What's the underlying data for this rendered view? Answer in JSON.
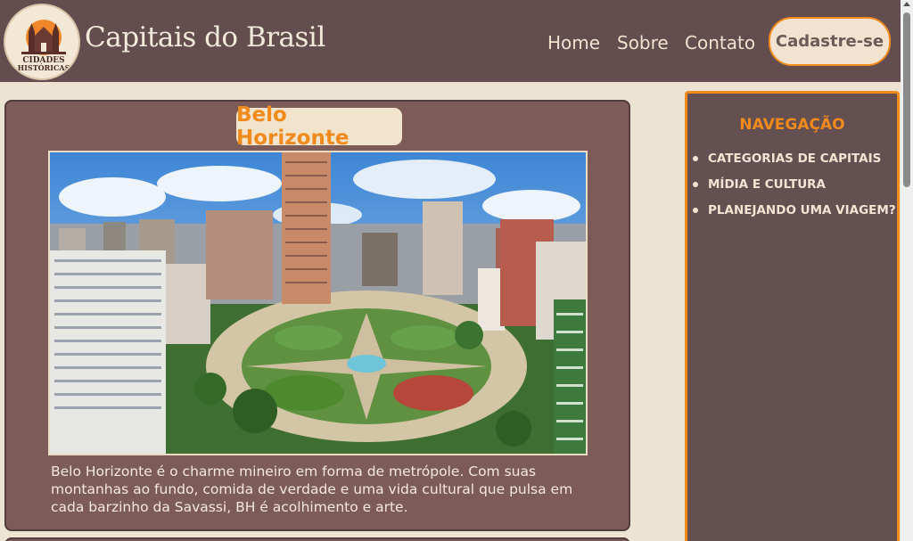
{
  "header": {
    "logo_text_line1": "CIDADES",
    "logo_text_line2": "HISTÓRICAS",
    "site_title": "Capitais do Brasil",
    "nav": {
      "home": "Home",
      "sobre": "Sobre",
      "contato": "Contato"
    },
    "signup_button": "Cadastre-se"
  },
  "article": {
    "title": "Belo Horizonte",
    "image_alt": "Belo Horizonte",
    "description": "Belo Horizonte é o charme mineiro em forma de metrópole. Com suas montanhas ao fundo, comida de verdade e uma vida cultural que pulsa em cada barzinho da Savassi, BH é acolhimento e arte."
  },
  "sidebar": {
    "title": "NAVEGAÇÃO",
    "items": [
      {
        "label": "CATEGORIAS DE CAPITAIS"
      },
      {
        "label": "MÍDIA E CULTURA"
      },
      {
        "label": "PLANEJANDO UMA VIAGEM?"
      }
    ]
  },
  "colors": {
    "header_bg": "#634d4f",
    "page_bg": "#ece3d2",
    "card_bg": "#7d5b59",
    "accent": "#f28a1c",
    "sidebar_bg": "#644f51"
  }
}
